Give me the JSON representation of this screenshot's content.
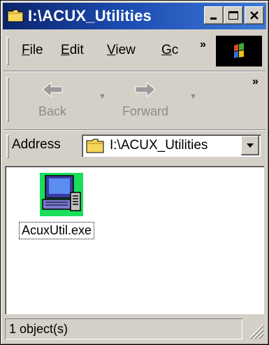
{
  "window": {
    "title": "I:\\ACUX_Utilities",
    "controls": {
      "minimize": "_",
      "maximize": "□",
      "close": "×"
    }
  },
  "menu": {
    "items": [
      {
        "label": "File",
        "mnemonic": "F"
      },
      {
        "label": "Edit",
        "mnemonic": "E"
      },
      {
        "label": "View",
        "mnemonic": "V"
      },
      {
        "label": "Gc",
        "mnemonic": "G"
      }
    ],
    "overflow": "»"
  },
  "toolbar": {
    "back_label": "Back",
    "forward_label": "Forward",
    "overflow": "»"
  },
  "address": {
    "label": "Address",
    "value": "I:\\ACUX_Utilities"
  },
  "files": [
    {
      "name": "AcuxUtil.exe",
      "icon": "computer-icon"
    }
  ],
  "status": {
    "text": "1 object(s)"
  },
  "colors": {
    "titlebar_start": "#0a246a",
    "titlebar_end": "#3c7ad6",
    "chrome": "#d4d0c8"
  }
}
